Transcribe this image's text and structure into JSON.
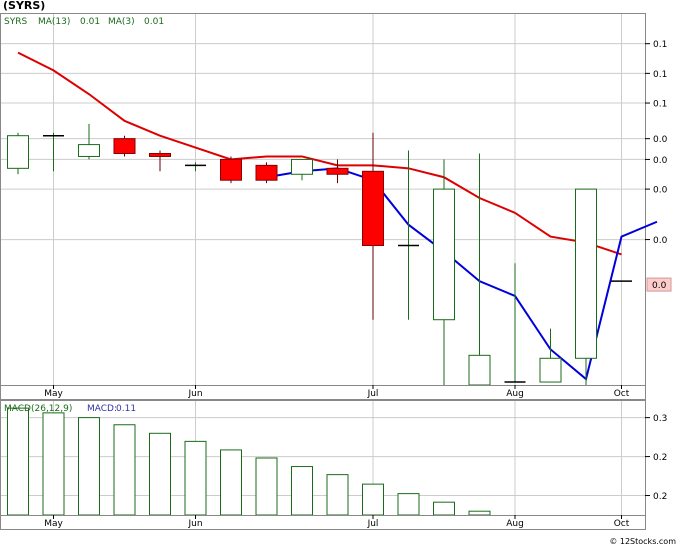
{
  "title": "(SYRS)",
  "footer": "© 12Stocks.com",
  "colors": {
    "up": "#1a6b1a",
    "down": "#ff0000",
    "ma13": "#dd0000",
    "ma3": "#0000dd",
    "macd": "#1a6b1a",
    "grid": "#cccccc",
    "ticker_label": "#1a6b1a",
    "macd_label": "#3333aa"
  },
  "chart_data": [
    {
      "type": "candlestick",
      "name": "price",
      "legend": {
        "ticker": "SYRS",
        "ma13_label": "MA(13)",
        "ma13_value": "0.01",
        "ma3_label": "MA(3)",
        "ma3_value": "0.01"
      },
      "ylim": [
        0.0,
        0.125
      ],
      "y_ticks": [
        {
          "v": 0.115,
          "label": "0.1"
        },
        {
          "v": 0.105,
          "label": "0.1"
        },
        {
          "v": 0.095,
          "label": "0.1"
        },
        {
          "v": 0.083,
          "label": "0.0"
        },
        {
          "v": 0.076,
          "label": "0.0"
        },
        {
          "v": 0.066,
          "label": "0.0"
        },
        {
          "v": 0.049,
          "label": "0.0"
        }
      ],
      "last_price_label": {
        "v": 0.034,
        "label": "0.0"
      },
      "x_ticks": [
        {
          "i": 1,
          "label": "May"
        },
        {
          "i": 5,
          "label": "Jun"
        },
        {
          "i": 10,
          "label": "Jul"
        },
        {
          "i": 14,
          "label": "Aug"
        },
        {
          "i": 17,
          "label": "Oct"
        }
      ],
      "candles": [
        {
          "o": 0.073,
          "h": 0.085,
          "l": 0.071,
          "c": 0.084
        },
        {
          "o": 0.084,
          "h": 0.085,
          "l": 0.072,
          "c": 0.084
        },
        {
          "o": 0.077,
          "h": 0.088,
          "l": 0.076,
          "c": 0.081
        },
        {
          "o": 0.083,
          "h": 0.084,
          "l": 0.077,
          "c": 0.078
        },
        {
          "o": 0.078,
          "h": 0.079,
          "l": 0.072,
          "c": 0.077
        },
        {
          "o": 0.074,
          "h": 0.075,
          "l": 0.072,
          "c": 0.074
        },
        {
          "o": 0.076,
          "h": 0.077,
          "l": 0.068,
          "c": 0.069
        },
        {
          "o": 0.074,
          "h": 0.075,
          "l": 0.068,
          "c": 0.069
        },
        {
          "o": 0.071,
          "h": 0.076,
          "l": 0.069,
          "c": 0.076
        },
        {
          "o": 0.073,
          "h": 0.076,
          "l": 0.068,
          "c": 0.071
        },
        {
          "o": 0.072,
          "h": 0.085,
          "l": 0.022,
          "c": 0.047
        },
        {
          "o": 0.047,
          "h": 0.079,
          "l": 0.022,
          "c": 0.047
        },
        {
          "o": 0.022,
          "h": 0.076,
          "l": 0.0,
          "c": 0.066
        },
        {
          "o": -0.015,
          "h": 0.078,
          "l": -0.015,
          "c": 0.01
        },
        {
          "o": 0.001,
          "h": 0.041,
          "l": 0.001,
          "c": 0.001
        },
        {
          "o": 0.001,
          "h": 0.019,
          "l": 0.001,
          "c": 0.009
        },
        {
          "o": 0.009,
          "h": 0.066,
          "l": -0.002,
          "c": 0.066
        },
        {
          "o": 0.035,
          "h": 0.035,
          "l": 0.035,
          "c": 0.035
        }
      ],
      "ma13": [
        0.112,
        0.106,
        0.098,
        0.089,
        0.084,
        0.08,
        0.076,
        0.077,
        0.077,
        0.074,
        0.074,
        0.073,
        0.07,
        0.063,
        0.058,
        0.05,
        0.048,
        0.044
      ],
      "ma3_start_index": 7,
      "ma3": [
        0.07,
        0.072,
        0.073,
        0.069,
        0.054,
        0.045,
        0.035,
        0.03,
        0.012,
        0.002,
        0.05,
        0.055
      ]
    },
    {
      "type": "bar",
      "name": "macd",
      "legend": {
        "label": "MACD(26,12,9)",
        "value_label": "MACD:",
        "value": "0.11"
      },
      "ylim": [
        0.1,
        0.34
      ],
      "y_ticks": [
        {
          "v": 0.305,
          "label": "0.3"
        },
        {
          "v": 0.223,
          "label": "0.2"
        },
        {
          "v": 0.141,
          "label": "0.2"
        }
      ],
      "x_ticks": [
        {
          "i": 1,
          "label": "May"
        },
        {
          "i": 5,
          "label": "Jun"
        },
        {
          "i": 10,
          "label": "Jul"
        },
        {
          "i": 14,
          "label": "Aug"
        },
        {
          "i": 17,
          "label": "Oct"
        }
      ],
      "values": [
        0.325,
        0.315,
        0.305,
        0.29,
        0.272,
        0.255,
        0.237,
        0.22,
        0.202,
        0.185,
        0.165,
        0.145,
        0.127,
        0.108,
        0.095,
        0.083,
        0.078
      ]
    }
  ]
}
